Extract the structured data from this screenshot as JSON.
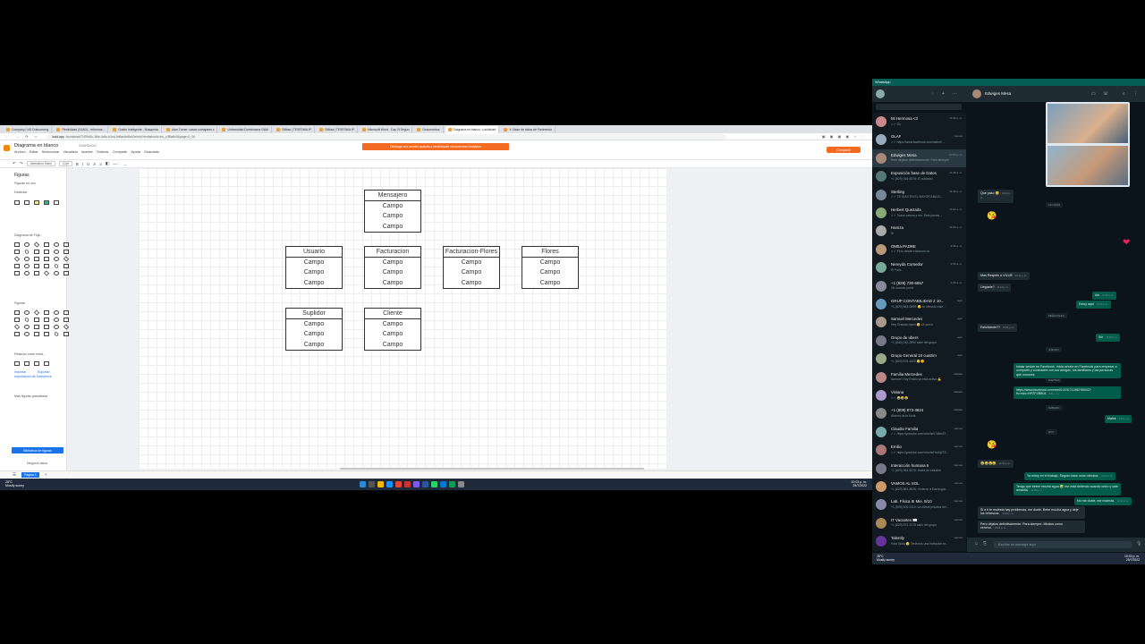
{
  "browser": {
    "tabs": [
      "Company | NS Outsourcing",
      "Flexibilidad (SJAD) - reformas...",
      "Gustin Inteligente - Búsqueda",
      "Alan Turner: casos sumajares c",
      "Universidad Dominicana O&M",
      "OMtaa | TESFDMA IP",
      "OMtaa | TESFDMA IP",
      "Microsoft Word - Cap 2f Según",
      "Documentos",
      "Diagrama en blanco: Lucidchart",
      "X: Base de datos de Pavimento"
    ],
    "url_host": "lucid.app",
    "url_rest": "/lucidchart/71f09d1c-3f6e-4c8c-b2ed-9d6ac6e8a10e/edit?invitationId=inv_c3f5a8c9&page=0_0#"
  },
  "app": {
    "doc_title": "Diagrama en blanco",
    "saved_status": "GUARDADO",
    "menus": [
      "Archivo",
      "Editar",
      "Seleccionar",
      "Visualizar",
      "Insertar",
      "Ordenar",
      "Compartir",
      "Ayuda",
      "Guardado"
    ],
    "banner": "Obtenga una prueba gratuita y desbloquee documentos ilimitados",
    "share_button": "Compartir",
    "font_name": "Liberation Sans",
    "font_size": "12pt",
    "shapes_title": "Figuras",
    "search_placeholder": "Figuras en uso",
    "sections": [
      "Estándar",
      "Diagrama de Flujo",
      "Figuras",
      "Relación entre entid...",
      "Más figuras grandiosas"
    ],
    "import_links": [
      "Importar",
      "Exportar",
      "Importación de Salesforce"
    ],
    "library_button": "Biblioteca de figuras",
    "page_tab": "Página 1",
    "footer_hint": "Ninguna datos"
  },
  "entities": [
    {
      "title": "Mensajero",
      "rows": [
        "Campo",
        "Campo",
        "Campo"
      ]
    },
    {
      "title": "Usuario",
      "rows": [
        "Campo",
        "Campo",
        "Campo"
      ]
    },
    {
      "title": "Facturacion",
      "rows": [
        "Campo",
        "Campo",
        "Campo"
      ]
    },
    {
      "title": "Facturacion-Flores",
      "rows": [
        "Campo",
        "Campo",
        "Campo"
      ]
    },
    {
      "title": "Flores",
      "rows": [
        "Campo",
        "Campo",
        "Campo"
      ]
    },
    {
      "title": "Suplidor",
      "rows": [
        "Campo",
        "Campo",
        "Campo"
      ]
    },
    {
      "title": "Cliente",
      "rows": [
        "Campo",
        "Campo",
        "Campo"
      ]
    }
  ],
  "taskbar": {
    "weather_temp": "28°C",
    "weather_desc": "Mostly sunny",
    "lang": "ESP LAA",
    "time": "10:03 p. m.",
    "date": "25/7/2022"
  },
  "whatsapp": {
    "window_title": "WhatsApp",
    "active_chat": "Edwiges Mesa",
    "chats": [
      {
        "name": "Mi Hermosa <3",
        "preview": "✓✓ Ok",
        "time": "11:49 p. m."
      },
      {
        "name": "OLAF",
        "preview": "✓✓ https://www.facebook.com/watch/...",
        "time": "Jueves"
      },
      {
        "name": "Edwiges Mesa",
        "preview": "Pero déjalos definitivamente. Para siempre",
        "time": "10:05 p. m."
      },
      {
        "name": "Exposición base de Datos",
        "preview": "+1 (829) 916-8078: El cuidado!",
        "time": "11:48 a. m."
      },
      {
        "name": "Sterling",
        "preview": "✓✓ TE IGAS EN EL MAYOR ABAJO...",
        "time": "11:46 a. m."
      },
      {
        "name": "Herbert Quezada",
        "preview": "✓✓ Todos vamos a ver. Este jueves...",
        "time": "11:02 a. m."
      },
      {
        "name": "Hamza",
        "preview": "Sí",
        "time": "11:00 a. m."
      },
      {
        "name": "OMtta PADRE",
        "preview": "✓✓ Pero desde entonces no",
        "time": "9:48 a. m."
      },
      {
        "name": "Nereyda Comedor",
        "preview": "El Pollo",
        "time": "9:48 a. m."
      },
      {
        "name": "+1 (829) 730-6957",
        "preview": "Ok cuando pued",
        "time": "9:25 a. m."
      },
      {
        "name": "GRUP CONTABILIDAD 2 10...",
        "preview": "+1 (829) 863-0895: 🙂 te ofrecido este...",
        "time": "ayer"
      },
      {
        "name": "Samuel Mercedes",
        "preview": "Hey Gracias mami 🙂 Un poco",
        "time": "ayer"
      },
      {
        "name": "Grupo de ubers",
        "preview": "+1 (849) 242-2890 salió del grupo",
        "time": "ayer"
      },
      {
        "name": "Grupo General 10 cuatrim",
        "preview": "+1 (829) 576-4420 🙂🙂",
        "time": "ayer"
      },
      {
        "name": "Familia Mercedes",
        "preview": "Samuel: Hoy Emilio ya está activo 💪",
        "time": "sábado"
      },
      {
        "name": "Viviana",
        "preview": "✓✓ 😂😂😂",
        "time": "sábado"
      },
      {
        "name": "+1 (809) 973-3824",
        "preview": "Alberto de la Mota",
        "time": "sábado"
      },
      {
        "name": "Claudio Familia",
        "preview": "✓✓ https://youtube.com/shorts/v7b8m3T...",
        "time": "viernes"
      },
      {
        "name": "Emilio",
        "preview": "✓✓ https://youtube.com/shorts/HmXj4TE...",
        "time": "viernes"
      },
      {
        "name": "Interacción humana 6",
        "preview": "+1 (829) 364-8276: Antes de estudiar",
        "time": "viernes"
      },
      {
        "name": "VAMOS AL SOL",
        "preview": "+1 (829) 861-8026: Vinieron a Darología...",
        "time": "viernes"
      },
      {
        "name": "Lab. Física III Mie. 8/10",
        "preview": "+1 (809) 405-3113: La última práctica del...",
        "time": "viernes"
      },
      {
        "name": "IT Vacantes 📖",
        "preview": "+1 (829) 572-2178 salió del grupo",
        "time": "viernes"
      },
      {
        "name": "Talently",
        "preview": "Hola Gilda 🙂 Tenemos una invitación te...",
        "time": "viernes"
      }
    ],
    "messages": [
      {
        "text": "Que paso 😊",
        "time": "10:02 p. m.",
        "dir": "in"
      },
      {
        "text": "11/7/2022",
        "time": "",
        "dir": "date"
      },
      {
        "text": "Mas Respeto a VILLIE",
        "time": "11:41 p. m.",
        "dir": "in"
      },
      {
        "text": "Llegaste?",
        "time": "11:12 p. m.",
        "dir": "in"
      },
      {
        "text": "Así",
        "time": "11:36 p. m.",
        "dir": "out"
      },
      {
        "text": "Estoy aquí",
        "time": "11:30 p. m.",
        "dir": "out"
      },
      {
        "text": "MIÉRCOLES",
        "time": "",
        "dir": "date"
      },
      {
        "text": "Estudiando??",
        "time": "12:01 p. m.",
        "dir": "in"
      },
      {
        "text": "JUEVES",
        "time": "",
        "dir": "date"
      },
      {
        "text": "Sííí",
        "time": "11:16 p. m.",
        "dir": "out"
      },
      {
        "text": "MARTES",
        "time": "",
        "dir": "date"
      },
      {
        "text": "Iniciar sesión en Facebook. Inicia sesión en Facebook para empezar a compartir y conectarte con tus amigos, tus familiares y las personas que conoces.",
        "time": "",
        "dir": "out"
      },
      {
        "text": "https://www.facebook.com/reel/1223171288755042?fs=e&s=NPZFZBB04",
        "time": "8:51 p. m.",
        "dir": "out"
      },
      {
        "text": "SÁBADO",
        "time": "",
        "dir": "date"
      },
      {
        "text": "Malek",
        "time": "8:53 p. m.",
        "dir": "out"
      },
      {
        "text": "HOY",
        "time": "",
        "dir": "date"
      },
      {
        "text": "😂😂😂😂",
        "time": "11:01 a. m.",
        "dir": "in"
      },
      {
        "text": "Ya estoy en el trabajo. Seguro hace unos minutos.",
        "time": "11:03 a. m.",
        "dir": "out"
      },
      {
        "text": "Tengo que beber mucha agua 😅 me está doliendo cuando orino y sale amarilla.",
        "time": "11:09 a. m.",
        "dir": "out"
      },
      {
        "text": "No me duele, me molesta.",
        "time": "11:14 a. m.",
        "dir": "out"
      },
      {
        "text": "Si a ti te molesta hay problemas, me duele. Bebe mucha agua y deje los refrescos.",
        "time": "11:09 p. m.",
        "dir": "in"
      },
      {
        "text": "Pero déjalos definitivamente. Para siempre. Miralos como veneno.",
        "time": "10:05 p. m.",
        "dir": "in"
      }
    ],
    "input_placeholder": "Escribe un mensaje aquí",
    "footer_time": "10:03 p. m.",
    "footer_date": "25/7/2022"
  },
  "colors": {
    "accent": "#f36b21",
    "lucid_blue": "#1a73e8",
    "wa_green": "#005c4b",
    "wa_bg": "#0b141a"
  }
}
